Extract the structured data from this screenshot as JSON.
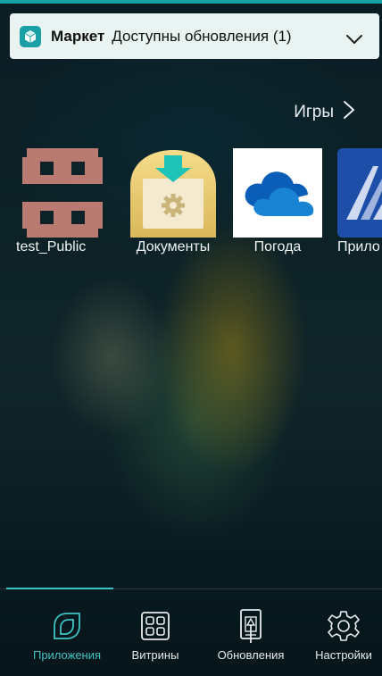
{
  "notification": {
    "app_icon": "market-cube-icon",
    "app_name": "Маркет",
    "message": "Доступны обновления (1)",
    "expand_icon": "chevron-down-icon"
  },
  "category": {
    "label": "Игры",
    "icon": "chevron-right-icon"
  },
  "apps": [
    {
      "label": "test_Public",
      "icon": "pixel-invader-icon"
    },
    {
      "label": "Документы",
      "icon": "documents-download-icon"
    },
    {
      "label": "Погода",
      "icon": "onedrive-cloud-icon"
    },
    {
      "label": "Прило",
      "icon": "app-blue-icon"
    }
  ],
  "tabs": [
    {
      "label": "Приложения",
      "icon": "leaf-icon",
      "active": true
    },
    {
      "label": "Витрины",
      "icon": "grid-icon",
      "active": false
    },
    {
      "label": "Обновления",
      "icon": "phone-update-icon",
      "active": false
    },
    {
      "label": "Настройки",
      "icon": "gear-icon",
      "active": false
    }
  ],
  "colors": {
    "accent": "#3fc3c2",
    "top_line": "#17a2a8",
    "notification_bg": "#e9f3f1"
  }
}
